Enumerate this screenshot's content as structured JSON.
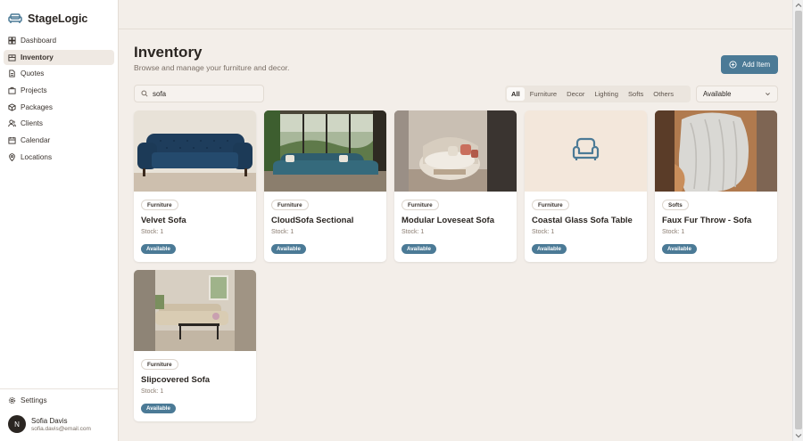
{
  "app": {
    "name": "StageLogic"
  },
  "sidebar": {
    "items": [
      {
        "label": "Dashboard",
        "icon": "dashboard-icon",
        "active": false
      },
      {
        "label": "Inventory",
        "icon": "inventory-icon",
        "active": true
      },
      {
        "label": "Quotes",
        "icon": "quotes-icon",
        "active": false
      },
      {
        "label": "Projects",
        "icon": "projects-icon",
        "active": false
      },
      {
        "label": "Packages",
        "icon": "packages-icon",
        "active": false
      },
      {
        "label": "Clients",
        "icon": "clients-icon",
        "active": false
      },
      {
        "label": "Calendar",
        "icon": "calendar-icon",
        "active": false
      },
      {
        "label": "Locations",
        "icon": "locations-icon",
        "active": false
      }
    ],
    "settings_label": "Settings",
    "user": {
      "initial": "N",
      "name": "Sofia Davis",
      "email": "sofia.davis@email.com"
    }
  },
  "page": {
    "title": "Inventory",
    "subtitle": "Browse and manage your furniture and decor.",
    "add_button": "Add Item"
  },
  "search": {
    "value": "sofa",
    "placeholder": "Search"
  },
  "filters": {
    "tabs": [
      "All",
      "Furniture",
      "Decor",
      "Lighting",
      "Softs",
      "Others"
    ],
    "active": "All"
  },
  "availability_select": {
    "value": "Available"
  },
  "items": [
    {
      "category": "Furniture",
      "name": "Velvet Sofa",
      "stock": "Stock: 1",
      "status": "Available",
      "image": "velvet-sofa-photo"
    },
    {
      "category": "Furniture",
      "name": "CloudSofa Sectional",
      "stock": "Stock: 1",
      "status": "Available",
      "image": "cloudsofa-photo"
    },
    {
      "category": "Furniture",
      "name": "Modular Loveseat Sofa",
      "stock": "Stock: 1",
      "status": "Available",
      "image": "loveseat-photo"
    },
    {
      "category": "Furniture",
      "name": "Coastal Glass Sofa Table",
      "stock": "Stock: 1",
      "status": "Available",
      "image": "placeholder-sofa-icon"
    },
    {
      "category": "Softs",
      "name": "Faux Fur Throw - Sofa",
      "stock": "Stock: 1",
      "status": "Available",
      "image": "throw-photo"
    },
    {
      "category": "Furniture",
      "name": "Slipcovered Sofa",
      "stock": "Stock: 1",
      "status": "Available",
      "image": "slipcovered-photo"
    }
  ],
  "colors": {
    "accent": "#4b7a96",
    "background": "#f3eee9",
    "card": "#ffffff"
  }
}
